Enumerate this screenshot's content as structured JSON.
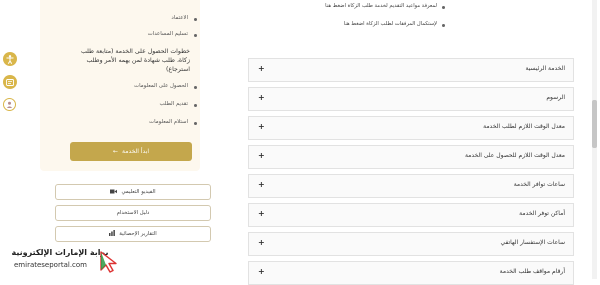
{
  "top_links": [
    "لمعرفة مواعيد التقديم لخدمة طلب الزكاة اضغط هنا",
    "لإستكمال المرفقات لطلب الزكاة اضغط هنا"
  ],
  "right_panel": {
    "item1": "الاعتماد",
    "item2": "تسليم المساعدات",
    "heading": "خطوات الحصول على الخدمة (متابعة طلب زكاة، طلب شهادة لمن يهمه الأمر وطلب استرجاع)",
    "steps": [
      "الحصول على المعلومات",
      "تقديم الطلب",
      "استلام المعلومات"
    ],
    "start_button": "ابدأ الخدمة"
  },
  "action_buttons": [
    {
      "label": "الفيديو التعليمي",
      "icon": "video-icon"
    },
    {
      "label": "دليل الاستخدام",
      "icon": ""
    },
    {
      "label": "التقارير الإحصائية",
      "icon": "chart-icon"
    }
  ],
  "accordion": [
    "الخدمة الرئيسية",
    "الرسوم",
    "معدل الوقت اللازم لطلب الخدمة",
    "معدل الوقت اللازم للحصول على الخدمة",
    "ساعات توافر الخدمة",
    "أماكن توفر الخدمة",
    "ساعات الإستفسار الهاتفي",
    "أرقام مواقف طلب الخدمة"
  ],
  "logo": {
    "arabic": "بوابة الإمارات الإلكترونية",
    "english": "emirateseportal.com"
  },
  "colors": {
    "accent": "#c4a74c",
    "side_icon": "#d9b64a",
    "panel_bg": "#fdf8ee"
  }
}
